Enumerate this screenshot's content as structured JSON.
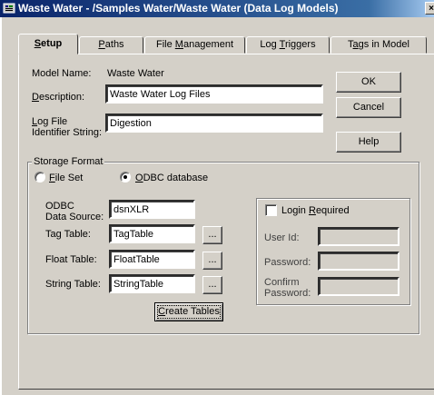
{
  "window": {
    "title": "Waste Water - /Samples Water/Waste Water (Data Log Models)",
    "icon": "db-icon",
    "close_glyph": "×"
  },
  "tabs": [
    {
      "pre": "",
      "ul": "S",
      "post": "etup",
      "active": true
    },
    {
      "pre": "",
      "ul": "P",
      "post": "aths",
      "active": false
    },
    {
      "pre": "File ",
      "ul": "M",
      "post": "anagement",
      "active": false
    },
    {
      "pre": "Log ",
      "ul": "T",
      "post": "riggers",
      "active": false
    },
    {
      "pre": "T",
      "ul": "a",
      "post": "gs in Model",
      "active": false
    }
  ],
  "setup": {
    "model_name_label": "Model Name:",
    "model_name_value": "Waste Water",
    "description_label_ul": "D",
    "description_label_rest": "escription:",
    "description_value": "Waste Water Log Files",
    "log_file_label_ul": "L",
    "log_file_label_rest": "og File",
    "log_file_label_line2": "Identifier String:",
    "log_file_value": "Digestion"
  },
  "buttons": {
    "ok": "OK",
    "cancel": "Cancel",
    "help": "Help"
  },
  "storage": {
    "legend": "Storage Format",
    "radio_fileset_ul": "F",
    "radio_fileset_rest": "ile Set",
    "radio_odbc_ul": "O",
    "radio_odbc_rest": "DBC database",
    "selected": "odbc",
    "odbc_label_line1": "ODBC",
    "odbc_label_line2": "Data Source:",
    "odbc_value": "dsnXLR",
    "tag_table_label": "Tag Table:",
    "tag_table_value": "TagTable",
    "float_table_label": "Float Table:",
    "float_table_value": "FloatTable",
    "string_table_label": "String Table:",
    "string_table_value": "StringTable",
    "browse_label": "...",
    "create_tables_ul": "C",
    "create_tables_rest": "reate Tables"
  },
  "login": {
    "checkbox_pre": "Login ",
    "checkbox_ul": "R",
    "checkbox_post": "equired",
    "checked": false,
    "user_id_label": "User Id:",
    "user_id_value": "",
    "password_label": "Password:",
    "password_value": "",
    "confirm_label_line1": "Confirm",
    "confirm_label_line2": "Password:",
    "confirm_value": ""
  }
}
